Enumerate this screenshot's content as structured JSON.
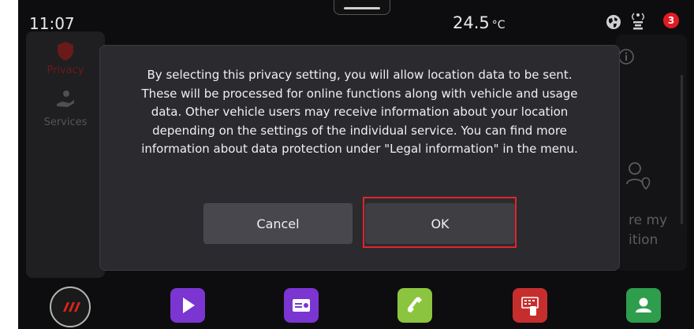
{
  "status_bar": {
    "time": "11:07",
    "temperature": "24.5",
    "temperature_unit": "°C",
    "notification_count": "3",
    "icons": [
      "globe-icon",
      "antenna-icon"
    ]
  },
  "background_app": {
    "sidebar_items": [
      "Privacy",
      "Services"
    ],
    "right_text_lines": [
      "re my",
      "ition"
    ]
  },
  "dialog": {
    "message": "By selecting this privacy setting, you will allow location data to be sent. These will be processed for online functions along with vehicle and usage data. Other vehicle users may receive information about your location depending on the settings of the individual service. You can find more information about data protection under \"Legal information\" in the menu.",
    "cancel_label": "Cancel",
    "ok_label": "OK"
  },
  "dock": {
    "items": [
      "home-icon",
      "media-icon",
      "radio-icon",
      "phone-icon",
      "apps-icon",
      "contacts-icon"
    ]
  },
  "colors": {
    "highlight": "#e0242c",
    "media": "#7b35d1",
    "phone": "#8bc53f",
    "apps": "#c62e2e",
    "contacts": "#2e9d4c",
    "badge": "#e11b22"
  }
}
